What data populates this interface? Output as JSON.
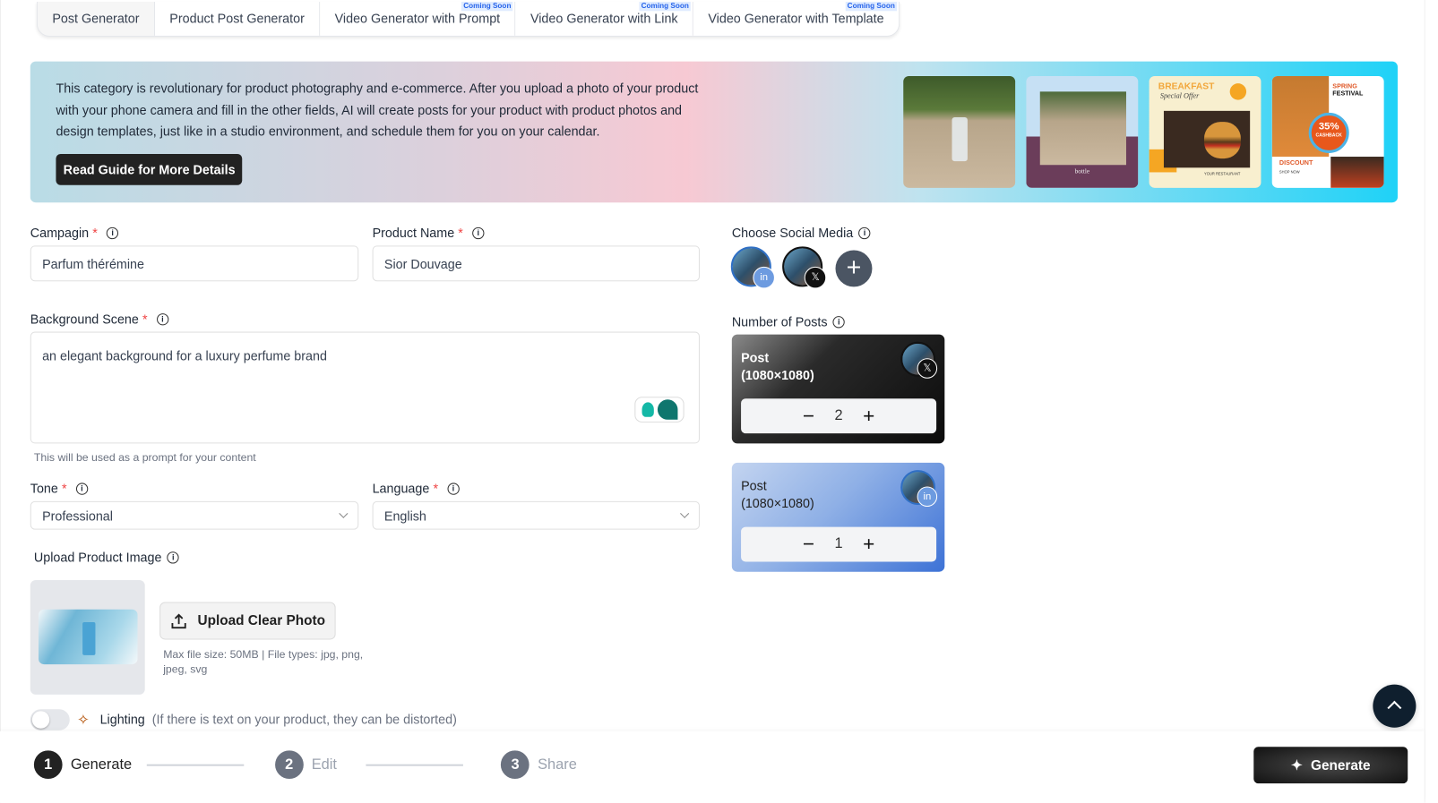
{
  "tabs": [
    {
      "label": "Post Generator"
    },
    {
      "label": "Product Post Generator"
    },
    {
      "label": "Video Generator with Prompt",
      "badge": "Coming Soon"
    },
    {
      "label": "Video Generator with Link",
      "badge": "Coming Soon"
    },
    {
      "label": "Video Generator with Template",
      "badge": "Coming Soon"
    }
  ],
  "banner": {
    "text": "This category is revolutionary for product photography and e-commerce. After you upload a photo of your product with your phone camera and fill in the other fields, AI will create posts for your product with product photos and design templates, just like in a studio environment, and schedule them for you on your calendar.",
    "button": "Read Guide for More Details",
    "thumbs": {
      "t2": "bottle",
      "t3a": "BREAKFAST",
      "t3b": "Special Offer",
      "t3c": "YOUR RESTAURANT",
      "t4a": "SPRING",
      "t4b": "FESTIVAL",
      "t4c": "35%",
      "t4d": "CASHBACK",
      "t4e": "DISCOUNT",
      "t4f": "SHOP NOW"
    }
  },
  "form": {
    "campaign": {
      "label": "Campagin",
      "value": "Parfum thérémine"
    },
    "product": {
      "label": "Product Name",
      "value": "Sior Douvage"
    },
    "scene": {
      "label": "Background Scene",
      "value": "an elegant background for a luxury perfume brand",
      "hint": "This will be used as a prompt for your content"
    },
    "tone": {
      "label": "Tone",
      "value": "Professional"
    },
    "language": {
      "label": "Language",
      "value": "English"
    },
    "upload": {
      "label": "Upload Product Image",
      "button": "Upload Clear Photo",
      "hint": "Max file size: 50MB | File types: jpg, png, jpeg, svg"
    },
    "lighting": {
      "label": "Lighting",
      "note": "(If there is text on your product, they can be distorted)",
      "enabled": false
    },
    "required": "*"
  },
  "social": {
    "label": "Choose Social Media",
    "accounts": [
      "linkedin",
      "x"
    ]
  },
  "posts": {
    "label": "Number of Posts",
    "cards": [
      {
        "title": "Post",
        "size": "(1080×1080)",
        "platform": "x",
        "count": "2"
      },
      {
        "title": "Post",
        "size": "(1080×1080)",
        "platform": "linkedin",
        "count": "1"
      }
    ]
  },
  "steps": [
    {
      "num": "1",
      "label": "Generate"
    },
    {
      "num": "2",
      "label": "Edit"
    },
    {
      "num": "3",
      "label": "Share"
    }
  ],
  "generate": "Generate",
  "colors": {
    "accent": "#222222",
    "linkedin": "#4a86d8",
    "required": "#ef4444"
  }
}
